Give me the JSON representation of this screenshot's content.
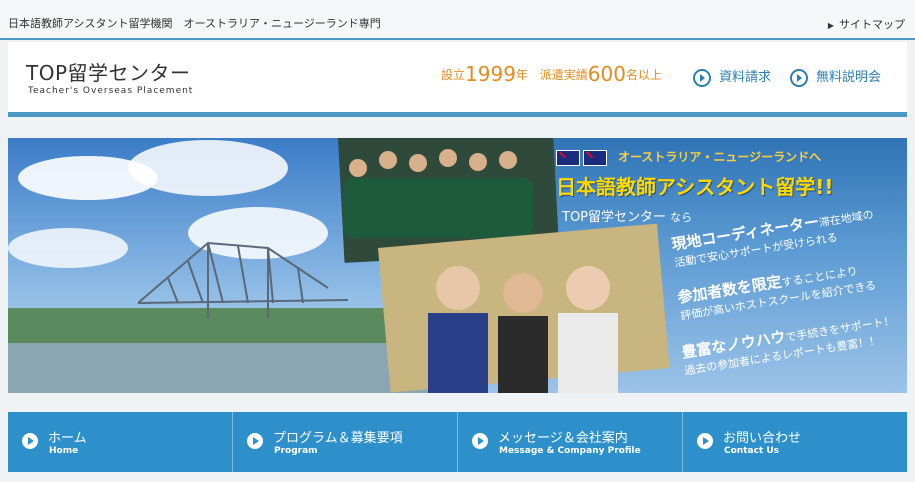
{
  "topbar": {
    "tagline": "日本語教師アシスタント留学機関　オーストラリア・ニュージーランド専門",
    "sitemap": "サイトマップ"
  },
  "header": {
    "logo_main": "TOP留学センター",
    "logo_sub": "Teacher's Overseas Placement",
    "est_prefix": "設立",
    "est_year": "1999",
    "est_year_unit": "年",
    "record_prefix": "派遣実績",
    "record_count": "600",
    "record_suffix": "名以上",
    "btn_materials": "資料請求",
    "btn_seminar": "無料説明会"
  },
  "hero": {
    "line1": "オーストラリア・ニュージーランドへ",
    "line2": "日本語教師アシスタント留学!!",
    "line3_main": "TOP留学センター",
    "line3_small": "なら",
    "features": [
      {
        "bold": "現地コーディネーター",
        "rest": "滞在地域の",
        "line2": "活動で安心サポートが受けられる"
      },
      {
        "bold": "参加者数を限定",
        "rest": "することにより",
        "line2": "評価が高いホストスクールを紹介できる"
      },
      {
        "bold": "豊富なノウハウ",
        "rest": "で手続きをサポート！",
        "line2": "過去の参加者によるレポートも豊富！！"
      }
    ]
  },
  "nav": [
    {
      "jp": "ホーム",
      "en": "Home"
    },
    {
      "jp": "プログラム＆募集要項",
      "en": "Program"
    },
    {
      "jp": "メッセージ＆会社案内",
      "en": "Message & Company Profile"
    },
    {
      "jp": "お問い合わせ",
      "en": "Contact Us"
    }
  ],
  "colors": {
    "accent": "#4b98c4",
    "nav_bg": "#2e90cb",
    "orange": "#e58b1e",
    "yellow": "#ffd800"
  }
}
